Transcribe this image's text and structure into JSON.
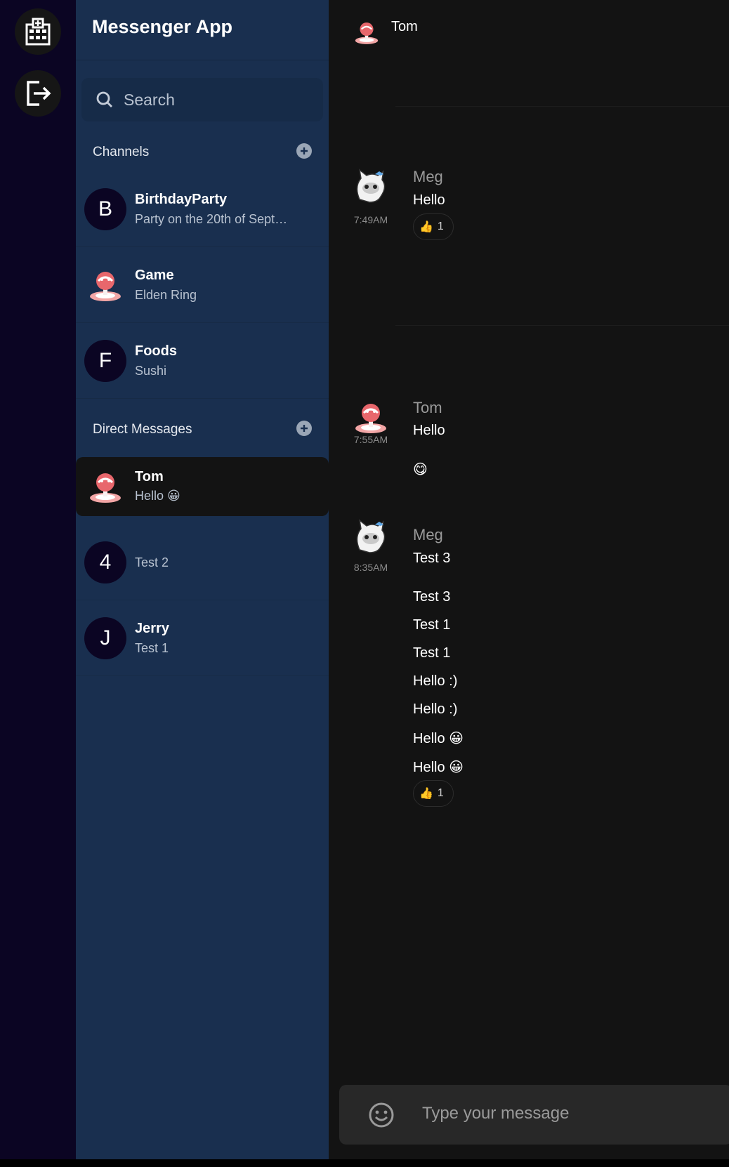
{
  "app": {
    "title": "Messenger App"
  },
  "rail": {
    "home_icon": "hospital-building-icon",
    "logout_icon": "logout-icon"
  },
  "search": {
    "placeholder": "Search"
  },
  "channels": {
    "label": "Channels",
    "items": [
      {
        "name": "BirthdayParty",
        "preview": "Party on the 20th of Sept…",
        "avatar_letter": "B"
      },
      {
        "name": "Game",
        "preview": "Elden Ring",
        "avatar_letter": ""
      },
      {
        "name": "Foods",
        "preview": "Sushi",
        "avatar_letter": "F"
      }
    ]
  },
  "direct_messages": {
    "label": "Direct Messages",
    "items": [
      {
        "name": "Tom",
        "preview": "Hello 😀",
        "avatar_letter": ""
      },
      {
        "name": "",
        "preview": "Test 2",
        "avatar_letter": "4"
      },
      {
        "name": "Jerry",
        "preview": "Test 1",
        "avatar_letter": "J"
      }
    ]
  },
  "chat": {
    "header_name": "Tom",
    "groups": [
      {
        "author": "Meg",
        "time": "7:49AM",
        "messages": [
          "Hello"
        ],
        "reaction": {
          "emoji": "👍",
          "count": "1"
        }
      },
      {
        "author": "Tom",
        "time": "7:55AM",
        "messages": [
          "Hello",
          "😋"
        ]
      },
      {
        "author": "Meg",
        "time": "8:35AM",
        "messages": [
          "Test 3",
          "Test 3",
          "Test 1",
          "Test 1",
          "Hello :)",
          "Hello :)",
          "Hello 😀",
          "Hello 😀"
        ],
        "reaction": {
          "emoji": "👍",
          "count": "1"
        }
      }
    ]
  },
  "composer": {
    "placeholder": "Type your message",
    "emoji_icon": "smiley-icon"
  },
  "colors": {
    "rail": "#0b0523",
    "sidebar": "#192f4f",
    "main": "#131313",
    "composer": "#282828"
  }
}
